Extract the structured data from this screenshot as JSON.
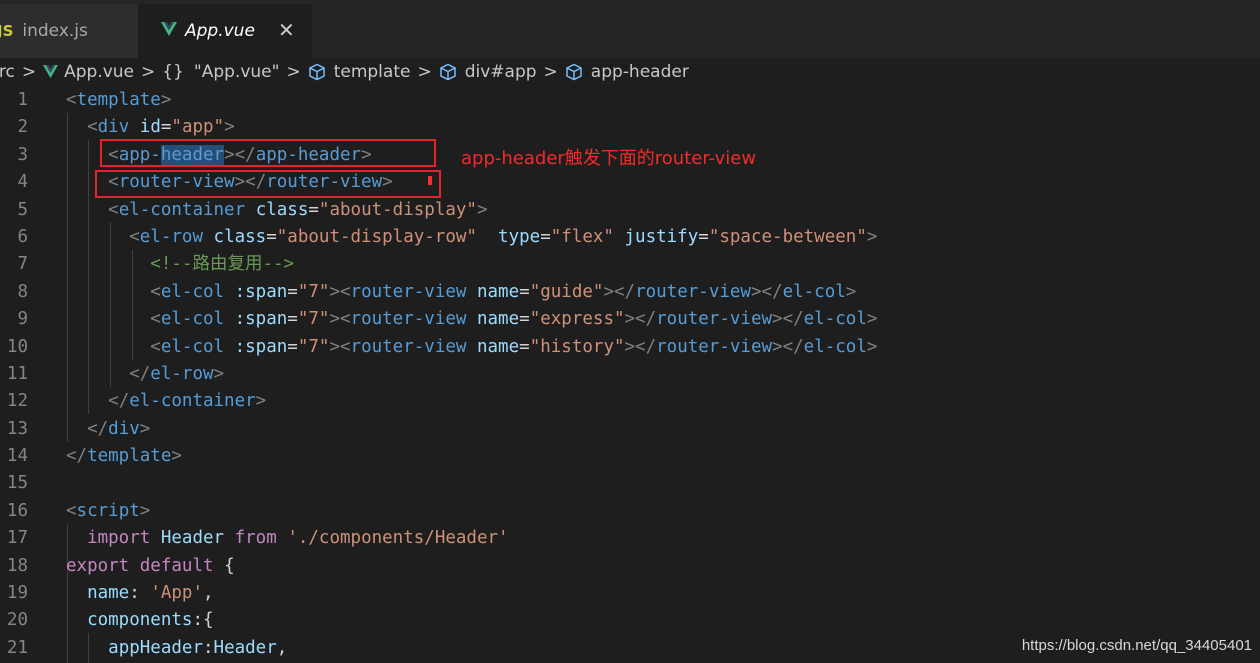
{
  "tabs": [
    {
      "icon": "js-icon",
      "icon_text": "JS",
      "label": "index.js"
    },
    {
      "icon": "vue-icon",
      "label": "App.vue",
      "close": "✕"
    }
  ],
  "breadcrumb": {
    "src": "src",
    "file": "App.vue",
    "braces": "{}",
    "module": "\"App.vue\"",
    "template": "template",
    "div": "div#app",
    "component": "app-header",
    "sep": ">"
  },
  "line_numbers": [
    "1",
    "2",
    "3",
    "4",
    "5",
    "6",
    "7",
    "8",
    "9",
    "10",
    "11",
    "12",
    "13",
    "14",
    "15",
    "16",
    "17",
    "18",
    "19",
    "20",
    "21"
  ],
  "annotation": "app-header触发下面的router-view",
  "watermark": "https://blog.csdn.net/qq_34405401",
  "colors": {
    "annotation": "#f12b2b",
    "box": "#e0252f",
    "background": "#1e1e1e"
  },
  "code": {
    "l1": [
      "<",
      "template",
      ">"
    ],
    "l2": [
      "  ",
      "<",
      "div",
      " ",
      "id",
      "=",
      "\"app\"",
      ">"
    ],
    "l3": [
      "    ",
      "<",
      "app-",
      "header",
      ">",
      "</",
      "app-header",
      ">"
    ],
    "l4": [
      "    ",
      "<",
      "router-view",
      ">",
      "</",
      "router-view",
      ">"
    ],
    "l5": [
      "    ",
      "<",
      "el-container",
      " ",
      "class",
      "=",
      "\"about-display\"",
      ">"
    ],
    "l6": [
      "      ",
      "<",
      "el-row",
      " ",
      "class",
      "=",
      "\"about-display-row\"",
      "  ",
      "type",
      "=",
      "\"flex\"",
      " ",
      "justify",
      "=",
      "\"space-between\"",
      ">"
    ],
    "l7": [
      "        ",
      "<!--路由复用-->"
    ],
    "l8": [
      "        ",
      "<",
      "el-col",
      " ",
      ":span",
      "=",
      "\"7\"",
      "><",
      "router-view",
      " ",
      "name",
      "=",
      "\"guide\"",
      "></",
      "router-view",
      "></",
      "el-col",
      ">"
    ],
    "l9": [
      "        ",
      "<",
      "el-col",
      " ",
      ":span",
      "=",
      "\"7\"",
      "><",
      "router-view",
      " ",
      "name",
      "=",
      "\"express\"",
      "></",
      "router-view",
      "></",
      "el-col",
      ">"
    ],
    "l10": [
      "        ",
      "<",
      "el-col",
      " ",
      ":span",
      "=",
      "\"7\"",
      "><",
      "router-view",
      " ",
      "name",
      "=",
      "\"history\"",
      "></",
      "router-view",
      "></",
      "el-col",
      ">"
    ],
    "l11": [
      "      ",
      "</",
      "el-row",
      ">"
    ],
    "l12": [
      "    ",
      "</",
      "el-container",
      ">"
    ],
    "l13": [
      "  ",
      "</",
      "div",
      ">"
    ],
    "l14": [
      "</",
      "template",
      ">"
    ],
    "l16": [
      "<",
      "script",
      ">"
    ],
    "l17": [
      "  ",
      "import",
      " ",
      "Header",
      " ",
      "from",
      " ",
      "'./components/Header'"
    ],
    "l18": [
      "export",
      " ",
      "default",
      " {"
    ],
    "l19": [
      "  ",
      "name",
      ": ",
      "'App'",
      ","
    ],
    "l20": [
      "  ",
      "components",
      ":{"
    ],
    "l21": [
      "    ",
      "appHeader",
      ":",
      "Header",
      ","
    ]
  }
}
